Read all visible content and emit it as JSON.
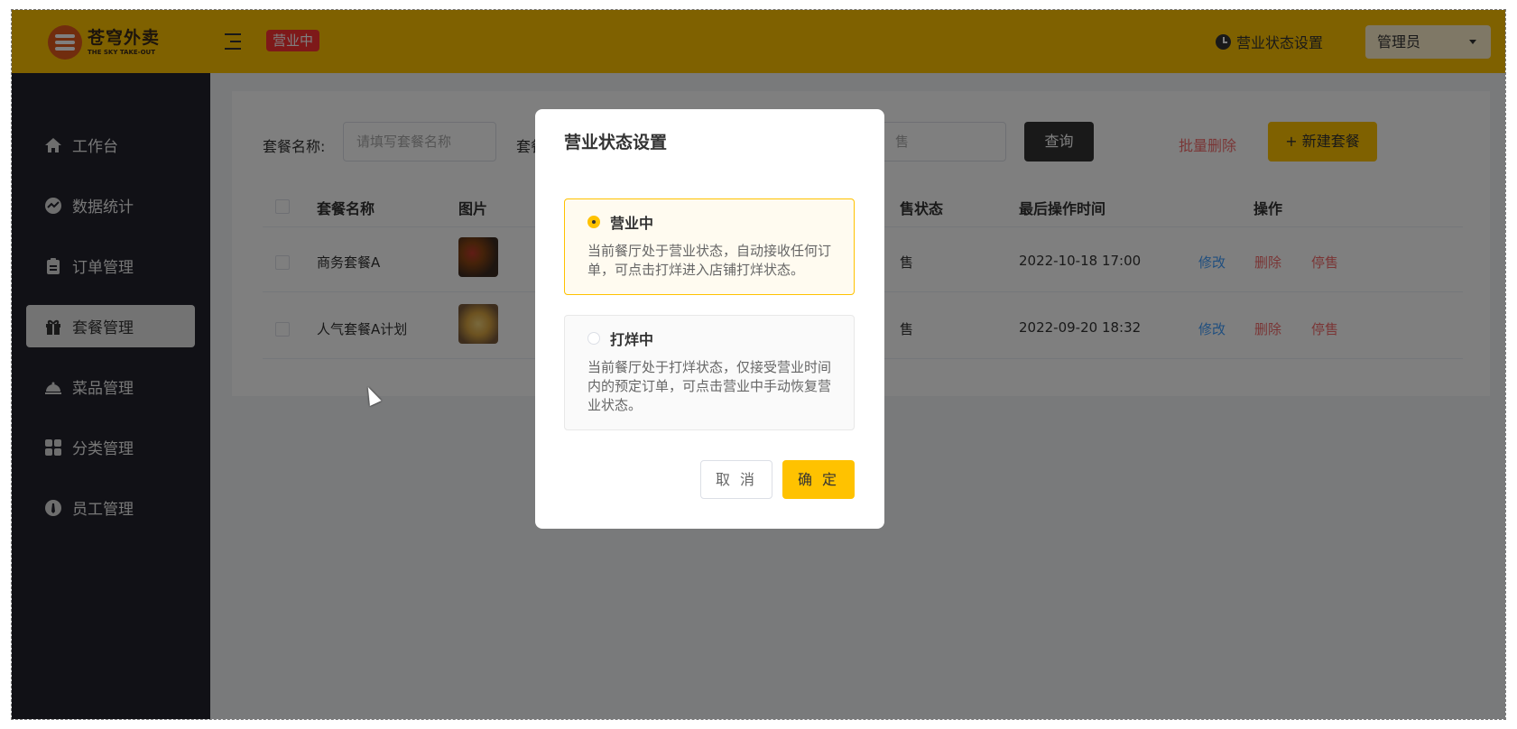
{
  "header": {
    "logo_cn": "苍穹外卖",
    "logo_en": "THE SKY TAKE-OUT",
    "status_tag": "营业中",
    "biz_setting": "营业状态设置",
    "admin": "管理员",
    "brand_color": "#ffc200"
  },
  "sidebar": {
    "items": [
      {
        "label": "工作台",
        "icon": "home-icon"
      },
      {
        "label": "数据统计",
        "icon": "chart-icon"
      },
      {
        "label": "订单管理",
        "icon": "clipboard-icon"
      },
      {
        "label": "套餐管理",
        "icon": "gift-icon",
        "active": true
      },
      {
        "label": "菜品管理",
        "icon": "dish-cover-icon"
      },
      {
        "label": "分类管理",
        "icon": "grid-icon"
      },
      {
        "label": "员工管理",
        "icon": "user-icon"
      }
    ]
  },
  "filters": {
    "name_label": "套餐名称:",
    "name_placeholder": "请填写套餐名称",
    "category_label": "套餐分",
    "status_value": "售",
    "query": "查询",
    "batch_delete": "批量删除",
    "new_combo": "+ 新建套餐"
  },
  "table": {
    "headers": {
      "name": "套餐名称",
      "image": "图片",
      "status": "售状态",
      "time": "最后操作时间",
      "ops": "操作"
    },
    "rows": [
      {
        "name": "商务套餐A",
        "status": "售",
        "time": "2022-10-18 17:00",
        "edit": "修改",
        "delete": "删除",
        "stop": "停售"
      },
      {
        "name": "人气套餐A计划",
        "status": "售",
        "time": "2022-09-20 18:32",
        "edit": "修改",
        "delete": "删除",
        "stop": "停售"
      }
    ]
  },
  "modal": {
    "title": "营业状态设置",
    "options": [
      {
        "name": "营业中",
        "desc": "当前餐厅处于营业状态，自动接收任何订单，可点击打烊进入店铺打烊状态。",
        "selected": true
      },
      {
        "name": "打烊中",
        "desc": "当前餐厅处于打烊状态，仅接受营业时间内的预定订单，可点击营业中手动恢复营业状态。",
        "selected": false
      }
    ],
    "cancel": "取 消",
    "confirm": "确 定"
  }
}
